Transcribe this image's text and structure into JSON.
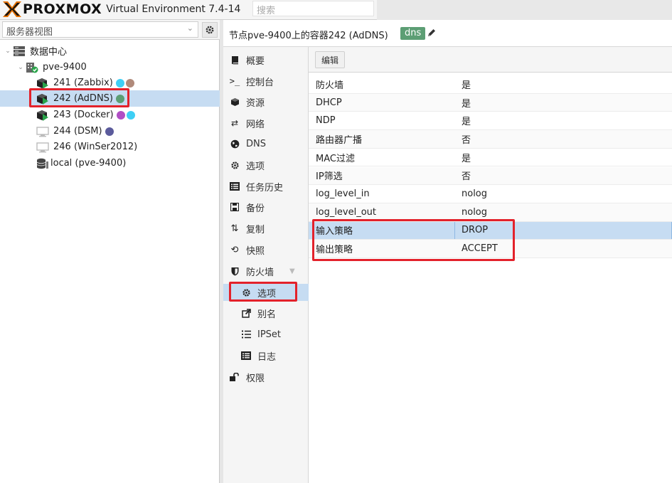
{
  "header": {
    "logo": "PROXMOX",
    "version": "Virtual Environment 7.4-14",
    "search_placeholder": "搜索"
  },
  "tree": {
    "view_label": "服务器视图",
    "datacenter": "数据中心",
    "node": "pve-9400",
    "items": [
      {
        "label": "241 (Zabbix)",
        "dots": [
          "#3ecff5",
          "#b08a7a"
        ]
      },
      {
        "label": "242 (AdDNS)",
        "dots": [
          "#5c9e74"
        ]
      },
      {
        "label": "243 (Docker)",
        "dots": [
          "#b04fc4",
          "#3ecff5"
        ]
      },
      {
        "label": "244 (DSM)",
        "dots": [
          "#5b5b9c"
        ]
      },
      {
        "label": "246 (WinSer2012)",
        "dots": []
      },
      {
        "label": "local (pve-9400)",
        "dots": []
      }
    ]
  },
  "content": {
    "title": "节点pve-9400上的容器242 (AdDNS)",
    "tag": "dns"
  },
  "nav": {
    "items": [
      {
        "label": "概要",
        "icon": "book-icon"
      },
      {
        "label": "控制台",
        "icon": "terminal-icon"
      },
      {
        "label": "资源",
        "icon": "cube-icon"
      },
      {
        "label": "网络",
        "icon": "exchange-icon"
      },
      {
        "label": "DNS",
        "icon": "globe-icon"
      },
      {
        "label": "选项",
        "icon": "gear-icon"
      },
      {
        "label": "任务历史",
        "icon": "list-icon"
      },
      {
        "label": "备份",
        "icon": "save-icon"
      },
      {
        "label": "复制",
        "icon": "retweet-icon"
      },
      {
        "label": "快照",
        "icon": "history-icon"
      },
      {
        "label": "防火墙",
        "icon": "shield-icon"
      },
      {
        "label": "选项",
        "icon": "gear-icon"
      },
      {
        "label": "别名",
        "icon": "external-link-icon"
      },
      {
        "label": "IPSet",
        "icon": "list-ol-icon"
      },
      {
        "label": "日志",
        "icon": "list-icon"
      },
      {
        "label": "权限",
        "icon": "unlock-icon"
      }
    ]
  },
  "toolbar": {
    "edit_label": "编辑"
  },
  "grid": {
    "rows": [
      {
        "key": "防火墙",
        "value": "是"
      },
      {
        "key": "DHCP",
        "value": "是"
      },
      {
        "key": "NDP",
        "value": "是"
      },
      {
        "key": "路由器广播",
        "value": "否"
      },
      {
        "key": "MAC过滤",
        "value": "是"
      },
      {
        "key": "IP筛选",
        "value": "否"
      },
      {
        "key": "log_level_in",
        "value": "nolog"
      },
      {
        "key": "log_level_out",
        "value": "nolog"
      },
      {
        "key": "输入策略",
        "value": "DROP"
      },
      {
        "key": "输出策略",
        "value": "ACCEPT"
      }
    ]
  }
}
